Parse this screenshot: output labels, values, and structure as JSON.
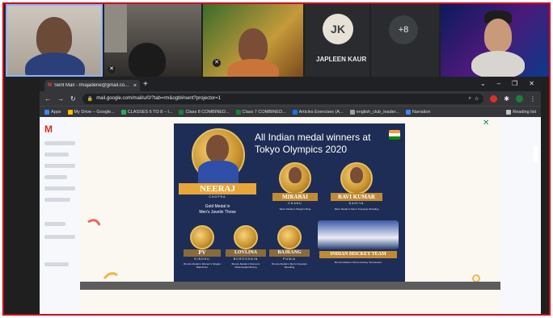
{
  "meet": {
    "participant_initials": "JK",
    "participant_name": "JAPLEEN KAUR",
    "more_count": "+8"
  },
  "browser": {
    "tab_title": "Sent Mail - rmajadene@gmail.co...",
    "address": "mail.google.com/mail/u/0/?tab=rm&ogbl#sent?projector=1",
    "bookmarks": [
      "Apps",
      "My Drive – Google...",
      "CLASSES 6 TO 8 – I...",
      "Class 8 COMBINED...",
      "Class 7 COMBINED...",
      "Articles Exercises (A...",
      "english_club_leader...",
      "Narration"
    ],
    "reading_list": "Reading list",
    "bookmark_colors": [
      "#4285f4",
      "#fbbc04",
      "#34a853",
      "#188038",
      "#188038",
      "#1a73e8",
      "#9aa0a6",
      "#4285f4"
    ]
  },
  "slide": {
    "title_line1": "All Indian medal winners at",
    "title_line2": "Tokyo Olympics 2020",
    "neeraj_name": "NEERAJ",
    "neeraj_surname": "CHOPRA",
    "neeraj_caption1": "Gold Medal in",
    "neeraj_caption2": "Men's Javelin Throw",
    "mirabai_name": "MIRABAI",
    "mirabai_surname": "CHANU",
    "mirabai_caption": "Silver Medal in Weight Lifting",
    "ravi_name": "RAVI KUMAR",
    "ravi_surname": "DAHIYA",
    "ravi_caption": "Silver Medal in Men's Freestyle Wrestling",
    "pv_name": "PV",
    "pv_surname": "SINDHU",
    "pv_caption": "Bronze Medal in Women's Singles Badminton",
    "lovlina_name": "LOVLINA",
    "lovlina_surname": "BORGOHAIN",
    "lovlina_caption": "Bronze Medal in Women's Welterweight Boxing",
    "bajrang_name": "BAJRANG",
    "bajrang_surname": "PUNIA",
    "bajrang_caption": "Bronze Medal in Men's Freestyle Wrestling",
    "hockey_name": "INDIAN HOCKEY TEAM",
    "hockey_caption": "Bronze Medal in Men's Hockey Tournament"
  }
}
